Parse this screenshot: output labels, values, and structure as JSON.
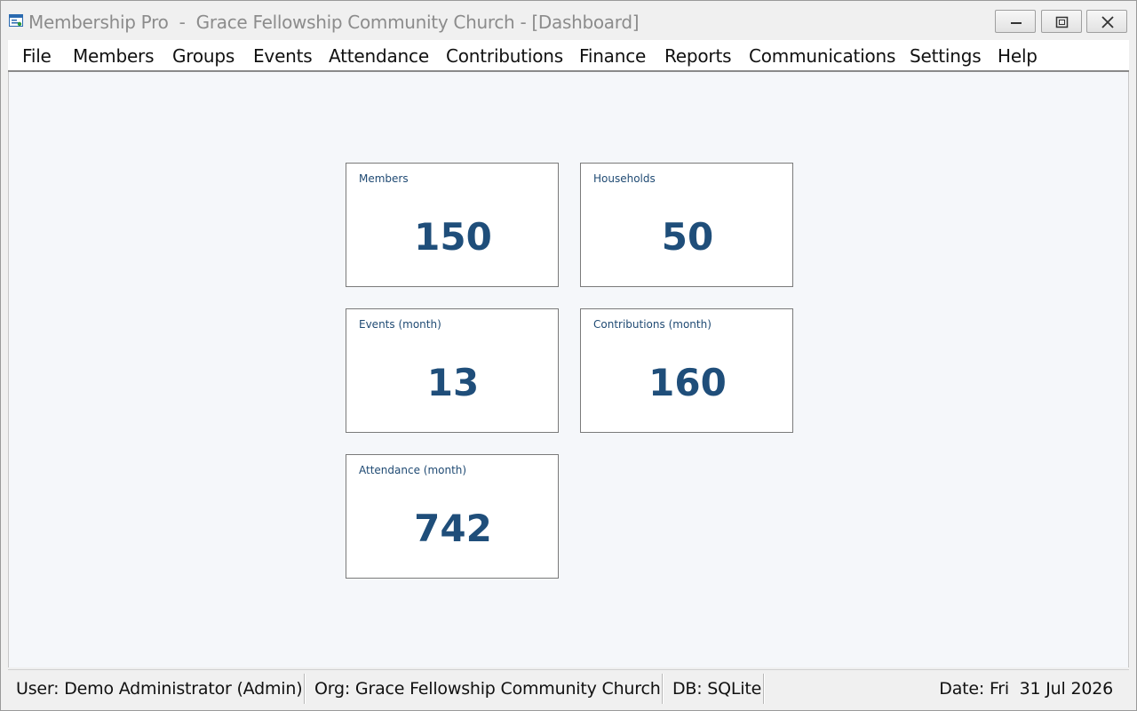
{
  "window": {
    "title": "Membership Pro  -  Grace Fellowship Community Church - [Dashboard]",
    "icon": "app-window-icon",
    "controls": {
      "minimize": "minimize-icon",
      "maximize": "restore-icon",
      "close": "close-icon"
    }
  },
  "menu": {
    "items": [
      "File",
      "Members",
      "Groups",
      "Events",
      "Attendance",
      "Contributions",
      "Finance",
      "Reports",
      "Communications",
      "Settings",
      "Help"
    ]
  },
  "dashboard": {
    "cards": [
      {
        "label": "Members",
        "value": "150"
      },
      {
        "label": "Households",
        "value": "50"
      },
      {
        "label": "Events (month)",
        "value": "13"
      },
      {
        "label": "Contributions (month)",
        "value": "160"
      },
      {
        "label": "Attendance (month)",
        "value": "742"
      }
    ],
    "accent_color": "#1f4e7a"
  },
  "status": {
    "user": "User: Demo Administrator (Admin)",
    "org": "Org: Grace Fellowship Community Church",
    "db": "DB: SQLite",
    "date": "Date: Fri  31 Jul 2026"
  }
}
